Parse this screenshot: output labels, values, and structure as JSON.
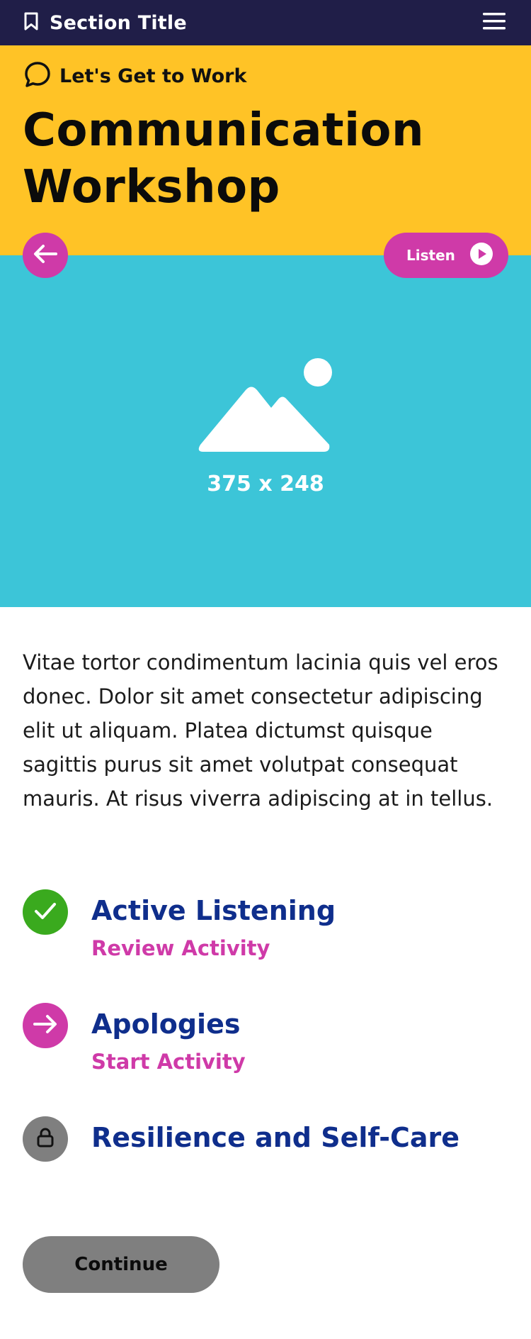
{
  "topbar": {
    "section_title": "Section Title",
    "bookmark_icon": "bookmark-icon",
    "menu_icon": "hamburger-menu-icon",
    "background": "#201e48"
  },
  "hero": {
    "eyebrow": "Let's Get to Work",
    "eyebrow_icon": "chat-bubble-icon",
    "title_line1": "Communication",
    "title_line2": "Workshop",
    "background": "#ffc326"
  },
  "controls": {
    "back_icon": "arrow-left-icon",
    "listen_label": "Listen",
    "listen_icon": "play-circle-icon",
    "accent": "#cf3aa8"
  },
  "image": {
    "placeholder_text": "375 x 248",
    "icon": "image-placeholder-icon",
    "background": "#3cc5d8"
  },
  "body": {
    "text": "Vitae tortor condimentum lacinia quis vel eros donec. Dolor sit amet consectetur adipiscing elit ut aliquam. Platea dictumst quisque sagittis purus sit amet volutpat consequat mauris. At risus viverra adipiscing at in tellus."
  },
  "activities": [
    {
      "title": "Active Listening",
      "action": "Review Activity",
      "status": "completed",
      "icon": "checkmark-icon",
      "color": "#3aaa1e"
    },
    {
      "title": "Apologies",
      "action": "Start Activity",
      "status": "available",
      "icon": "arrow-right-icon",
      "color": "#cf3aa8"
    },
    {
      "title": "Resilience and Self-Care",
      "action": "",
      "status": "locked",
      "icon": "lock-icon",
      "color": "#7f7f7f"
    }
  ],
  "footer": {
    "continue_label": "Continue"
  }
}
